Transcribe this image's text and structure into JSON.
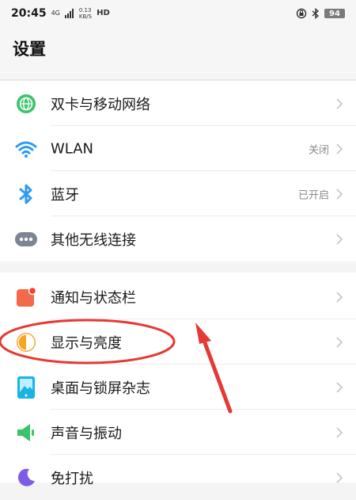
{
  "status_bar": {
    "time": "20:45",
    "network": "4G",
    "speed_value": "0.13",
    "speed_unit": "KB/S",
    "hd": "HD",
    "battery": "94"
  },
  "header": {
    "title": "设置"
  },
  "group1": [
    {
      "label": "双卡与移动网络",
      "value": "",
      "icon": "globe-icon",
      "color": "#3ec46d"
    },
    {
      "label": "WLAN",
      "value": "关闭",
      "icon": "wifi-icon",
      "color": "#2e9bf0"
    },
    {
      "label": "蓝牙",
      "value": "已开启",
      "icon": "bluetooth-icon",
      "color": "#2e9bf0"
    },
    {
      "label": "其他无线连接",
      "value": "",
      "icon": "more-icon",
      "color": "#7d8593"
    }
  ],
  "group2": [
    {
      "label": "通知与状态栏",
      "value": "",
      "icon": "notification-icon",
      "color": "#f26a4b"
    },
    {
      "label": "显示与亮度",
      "value": "",
      "icon": "brightness-icon",
      "color": "#f6a623"
    },
    {
      "label": "桌面与锁屏杂志",
      "value": "",
      "icon": "wallpaper-icon",
      "color": "#19b3e6"
    },
    {
      "label": "声音与振动",
      "value": "",
      "icon": "sound-icon",
      "color": "#39c36b"
    },
    {
      "label": "免打扰",
      "value": "",
      "icon": "moon-icon",
      "color": "#7d5ce6"
    }
  ],
  "annotation_color": "#e53935"
}
